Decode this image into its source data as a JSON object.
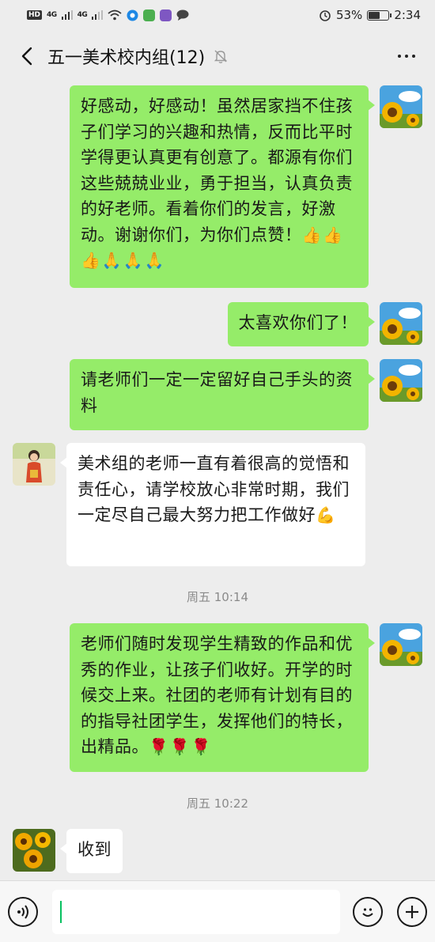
{
  "status_bar": {
    "left_badge": "HD",
    "signal1": "4G",
    "signal2": "4G",
    "battery": "53%",
    "time": "2:34"
  },
  "header": {
    "title": "五一美术校内组(12)",
    "icons": {
      "back": "back-chevron-icon",
      "mute": "mute-bell-icon",
      "more": "more-dots-icon"
    }
  },
  "messages": [
    {
      "side": "right",
      "text": "好感动，好感动！虽然居家挡不住孩子们学习的兴趣和热情，反而比平时学得更认真更有创意了。都源有你们这些兢兢业业，勇于担当，认真负责的好老师。看着你们的发言，好激动。谢谢你们，为你们点赞！",
      "emoji": "👍👍👍🙏🙏🙏"
    },
    {
      "side": "right",
      "text": "太喜欢你们了！"
    },
    {
      "side": "right",
      "text": "请老师们一定一定留好自己手头的资料"
    },
    {
      "side": "left",
      "text": "美术组的老师一直有着很高的觉悟和责任心，请学校放心非常时期，我们一定尽自己最大努力把工作做好",
      "emoji": "💪"
    },
    {
      "side": "right",
      "text": "老师们随时发现学生精致的作品和优秀的作业，让孩子们收好。开学的时候交上来。社团的老师有计划有目的的指导社团学生，发挥他们的特长，出精品。",
      "emoji": "🌹🌹🌹"
    },
    {
      "side": "left",
      "text": "收到"
    }
  ],
  "timestamps": [
    "周五 10:14",
    "周五 10:22"
  ],
  "input_bar": {
    "value": "",
    "icons": {
      "voice": "voice-icon",
      "emoji": "emoji-face-icon",
      "add": "plus-icon"
    }
  },
  "colors": {
    "sent_bubble": "#95ec69",
    "received_bubble": "#ffffff",
    "background": "#ededed"
  }
}
